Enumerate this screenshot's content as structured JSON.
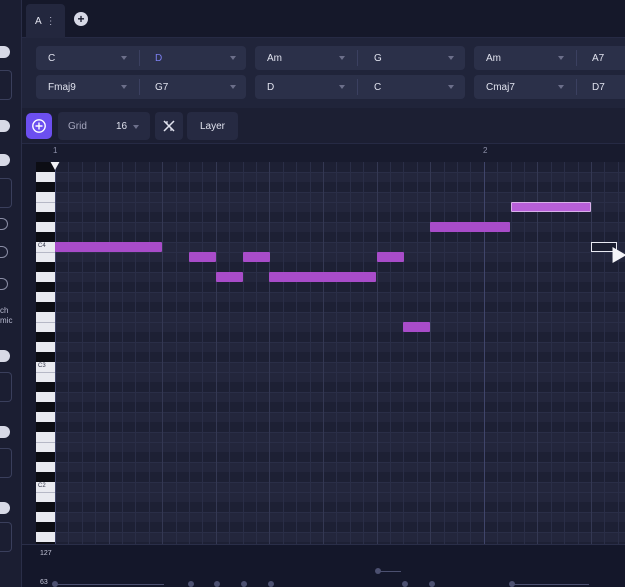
{
  "tabs": [
    {
      "label": "A",
      "active": true
    }
  ],
  "chord_rows": [
    [
      {
        "a": "C",
        "b": "D",
        "b_color": "#7b7ff0"
      },
      {
        "a": "Am",
        "b": "G"
      },
      {
        "a": "Am",
        "b": "A7"
      }
    ],
    [
      {
        "a": "Fmaj9",
        "b": "G7"
      },
      {
        "a": "D",
        "b": "C"
      },
      {
        "a": "Cmaj7",
        "b": "D7"
      }
    ]
  ],
  "toolbar": {
    "grid_label": "Grid",
    "grid_value": "16",
    "layer_label": "Layer"
  },
  "ruler": {
    "bar1": "1",
    "bar2": "2"
  },
  "keyboard": {
    "c4": "C4",
    "c3": "C3",
    "c2": "C2"
  },
  "side_panel": {
    "text_line1": "ch",
    "text_line2": "mic"
  },
  "velocity": {
    "top_label": "127",
    "bottom_label": "63"
  },
  "colors": {
    "accent": "#6c4ff0",
    "note": "#a84cc9",
    "chord_highlight": "#7b7ff0"
  },
  "icons": {
    "magic_button": "sparkle-plus-icon",
    "quantize_button": "quantize-icon",
    "add_tab": "plus-icon",
    "tab_menu": "kebab-icon"
  }
}
